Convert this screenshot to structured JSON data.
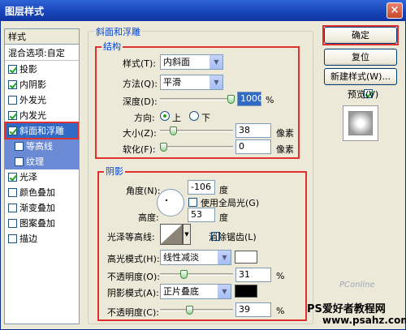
{
  "window": {
    "title": "图层样式",
    "close_glyph": "×"
  },
  "styles_list": {
    "header": "样式",
    "blend_options": "混合选项:自定",
    "items": [
      {
        "label": "投影",
        "checked": true
      },
      {
        "label": "内阴影",
        "checked": true
      },
      {
        "label": "外发光",
        "checked": false
      },
      {
        "label": "内发光",
        "checked": true
      },
      {
        "label": "斜面和浮雕",
        "checked": true,
        "selected": true
      },
      {
        "label": "等高线",
        "checked": false,
        "sub": true
      },
      {
        "label": "纹理",
        "checked": false,
        "sub": true
      },
      {
        "label": "光泽",
        "checked": true
      },
      {
        "label": "颜色叠加",
        "checked": false
      },
      {
        "label": "渐变叠加",
        "checked": false
      },
      {
        "label": "图案叠加",
        "checked": false
      },
      {
        "label": "描边",
        "checked": false
      }
    ]
  },
  "bevel": {
    "group_title": "斜面和浮雕",
    "structure_title": "结构",
    "style_label": "样式(T):",
    "style_value": "内斜面",
    "method_label": "方法(Q):",
    "method_value": "平滑",
    "depth_label": "深度(D):",
    "depth_value": "1000",
    "depth_unit": "%",
    "depth_level_pct": 100,
    "direction_label": "方向:",
    "direction_up": "上",
    "direction_down": "下",
    "size_label": "大小(Z):",
    "size_value": "38",
    "size_unit": "像素",
    "size_level_pct": 15,
    "soften_label": "软化(F):",
    "soften_value": "0",
    "soften_unit": "像素",
    "soften_level_pct": 0
  },
  "shading": {
    "title": "阴影",
    "angle_label": "角度(N):",
    "angle_value": "-106",
    "angle_unit": "度",
    "global_light_label": "使用全局光(G)",
    "altitude_label": "高度:",
    "altitude_value": "53",
    "altitude_unit": "度",
    "gloss_contour_label": "光泽等高线:",
    "anti_alias_label": "消除锯齿(L)",
    "highlight_mode_label": "高光模式(H):",
    "highlight_mode_value": "线性减淡",
    "highlight_color": "#ffffff",
    "highlight_opacity_label": "不透明度(O):",
    "highlight_opacity_value": "31",
    "highlight_opacity_unit": "%",
    "highlight_opacity_level_pct": 31,
    "shadow_mode_label": "阴影模式(A):",
    "shadow_mode_value": "正片叠底",
    "shadow_color": "#000000",
    "shadow_opacity_label": "不透明度(C):",
    "shadow_opacity_value": "39",
    "shadow_opacity_unit": "%",
    "shadow_opacity_level_pct": 39
  },
  "buttons": {
    "ok": "确定",
    "reset": "复位",
    "new_style": "新建样式(W)...",
    "preview_label": "预览(V)"
  },
  "watermark": {
    "site_name": "PS爱好者教程网",
    "url": "www.psahz.com",
    "logo": "PConline"
  }
}
